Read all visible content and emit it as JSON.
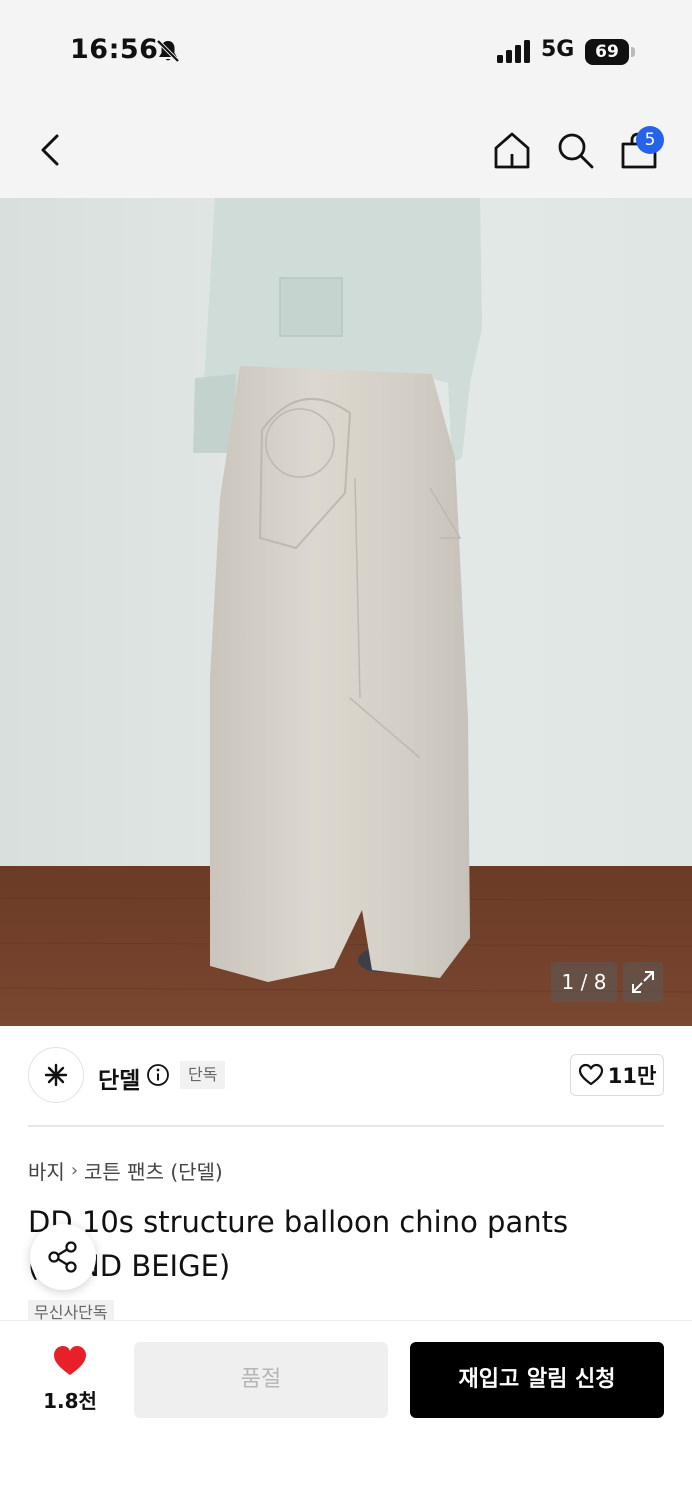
{
  "status_bar": {
    "time": "16:56",
    "network": "5G",
    "battery": "69"
  },
  "header": {
    "cart_badge": "5",
    "icons": [
      "back-arrow-icon",
      "home-icon",
      "search-icon",
      "shopping-bag-icon"
    ]
  },
  "gallery": {
    "counter": "1 / 8"
  },
  "brand": {
    "name": "단델",
    "tag": "단독",
    "likes": "11만"
  },
  "breadcrumb": {
    "category": "바지",
    "subcategory": "코튼 팬츠 (단델)"
  },
  "product": {
    "title": "DD 10s structure balloon chino pants (SAND BEIGE)",
    "store_tag": "무신사단독"
  },
  "actions": {
    "wish_count": "1.8천",
    "soldout_label": "품절",
    "restock_label": "재입고 알림 신청"
  },
  "colors": {
    "accent_badge": "#2563eb",
    "heart": "#e8202a",
    "primary_button": "#000000"
  }
}
